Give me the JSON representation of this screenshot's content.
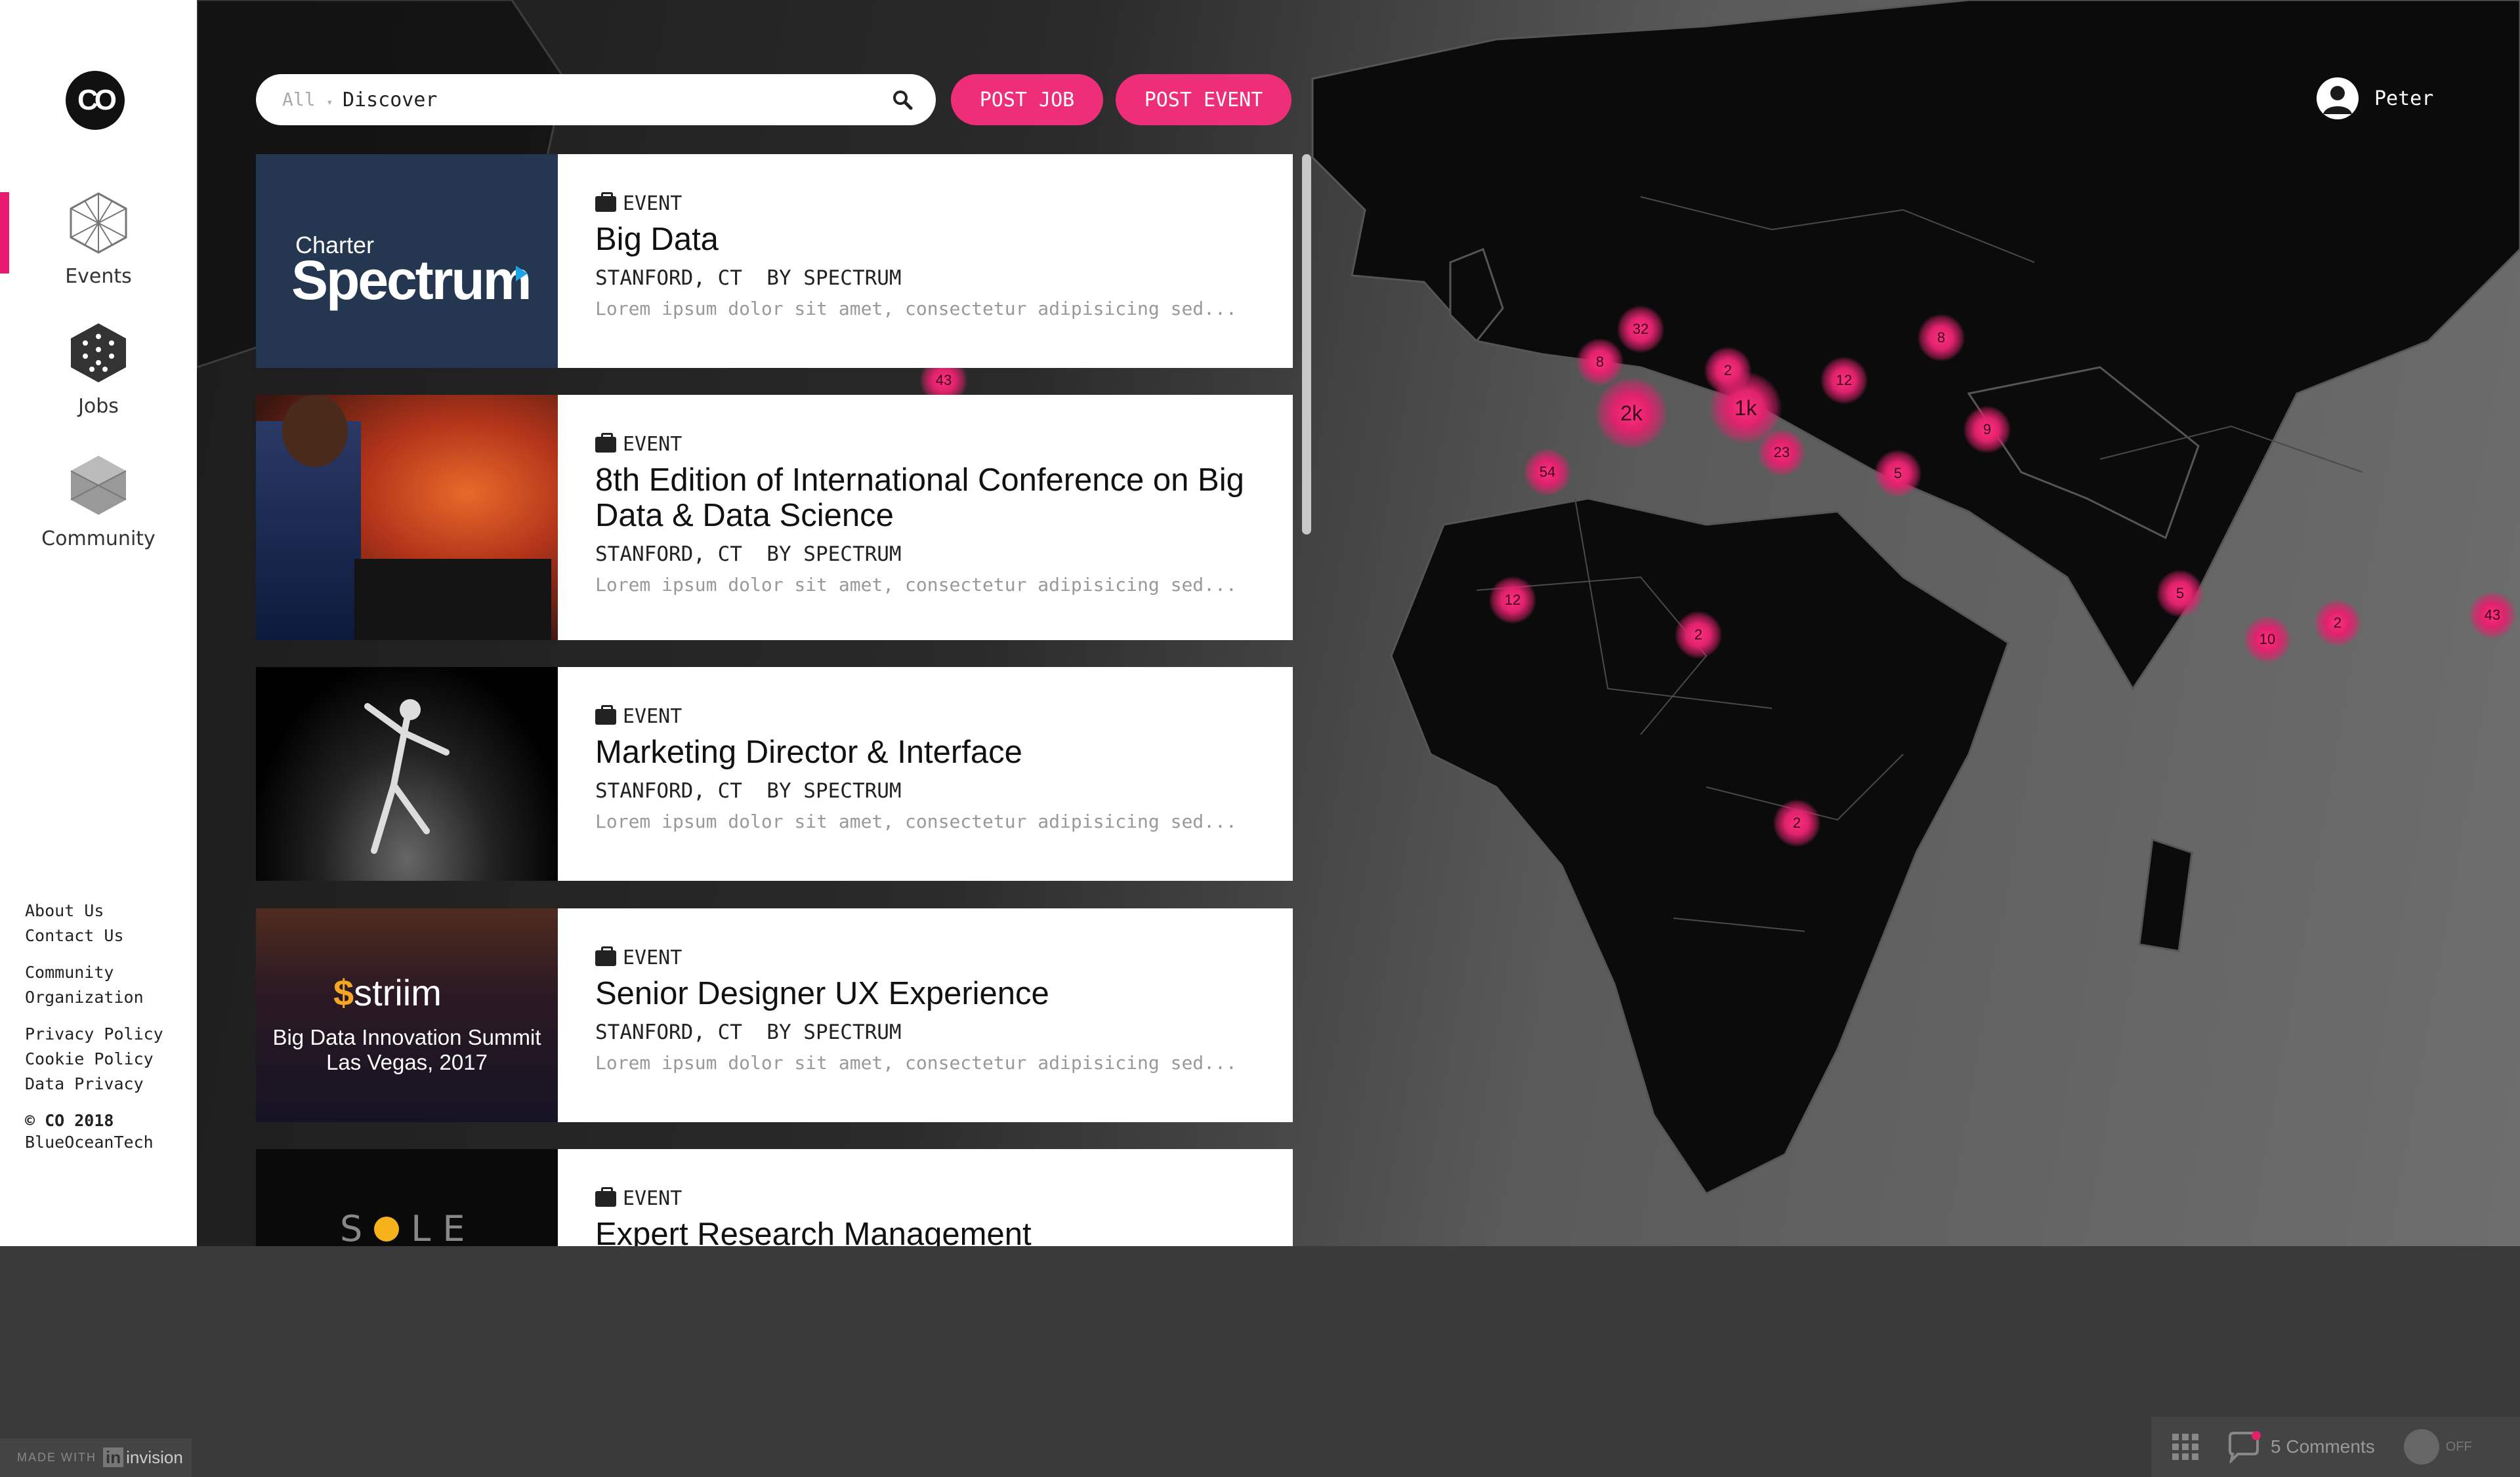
{
  "sidebar": {
    "logo_text": "CO",
    "nav": [
      {
        "label": "Events",
        "icon": "events-hex-icon",
        "active": true
      },
      {
        "label": "Jobs",
        "icon": "jobs-hex-icon"
      },
      {
        "label": "Community",
        "icon": "community-hex-icon"
      }
    ],
    "footer": {
      "about": "About Us",
      "contact": "Contact Us",
      "community": "Community",
      "organization": "Organization",
      "privacy": "Privacy Policy",
      "cookie": "Cookie Policy",
      "data_privacy": "Data Privacy",
      "copyright": "© CO 2018",
      "company": "BlueOceanTech"
    }
  },
  "search": {
    "scope": "All",
    "query": "Discover"
  },
  "actions": {
    "post_job": "POST JOB",
    "post_event": "POST EVENT"
  },
  "user": {
    "name": "Peter"
  },
  "events": [
    {
      "tag": "EVENT",
      "title": "Big Data",
      "location": "STANFORD, CT",
      "by": "BY SPECTRUM",
      "desc": "Lorem ipsum dolor sit amet, consectetur adipisicing sed...",
      "thumb_text1": "Charter",
      "thumb_text2": "Spectrum"
    },
    {
      "tag": "EVENT",
      "title": "8th Edition of International Conference on Big Data & Data Science",
      "location": "STANFORD, CT",
      "by": "BY SPECTRUM",
      "desc": "Lorem ipsum dolor sit amet, consectetur adipisicing sed..."
    },
    {
      "tag": "EVENT",
      "title": "Marketing Director & Interface",
      "location": "STANFORD, CT",
      "by": "BY SPECTRUM",
      "desc": "Lorem ipsum dolor sit amet, consectetur adipisicing sed..."
    },
    {
      "tag": "EVENT",
      "title": "Senior Designer UX Experience",
      "location": "STANFORD, CT",
      "by": "BY SPECTRUM",
      "desc": "Lorem ipsum dolor sit amet, consectetur adipisicing sed...",
      "thumb_text1": "striim",
      "thumb_text2": "Big Data Innovation Summit",
      "thumb_text3": "Las Vegas, 2017"
    },
    {
      "tag": "EVENT",
      "title": "Expert Research Management",
      "thumb_text1": "S",
      "thumb_text2": "LE"
    }
  ],
  "map_clusters": [
    "43",
    "32",
    "8",
    "2k",
    "2",
    "1k",
    "12",
    "8",
    "9",
    "23",
    "54",
    "5",
    "12",
    "2",
    "5",
    "10",
    "2",
    "43",
    "2"
  ],
  "footer_tools": {
    "made_with": "MADE WITH",
    "invision": "invision",
    "comments": "5 Comments",
    "toggle": "OFF"
  },
  "colors": {
    "accent": "#ef2e79",
    "cluster": "#e0226d",
    "sidebar": "#ffffff"
  }
}
